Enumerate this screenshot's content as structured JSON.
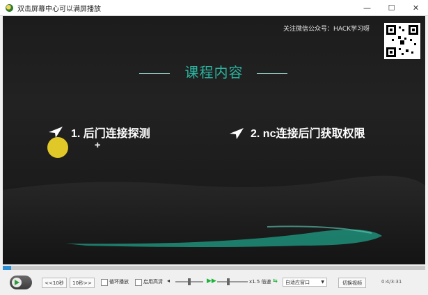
{
  "window": {
    "title": "双击屏幕中心可以满屏播放",
    "minimize": "—",
    "maximize": "☐",
    "close": "✕"
  },
  "video": {
    "wechat_text": "关注微信公众号：HACK学习呀",
    "slide_title": "课程内容",
    "items": [
      {
        "label": "1. 后门连接探测"
      },
      {
        "label": "2. nc连接后门获取权限"
      }
    ],
    "progress": 0.02,
    "colors": {
      "accent": "#2bb5a0",
      "cursor_highlight": "#f0d728"
    }
  },
  "controls": {
    "back_label": "<<10秒",
    "forward_label": "10秒>>",
    "loop_label": "循环播放",
    "hd_label": "启用高清",
    "speed_label": "x1.5 倍速",
    "fit_select_value": "自适应窗口",
    "switch_label": "切换视频",
    "time": "0:4/3:31"
  }
}
